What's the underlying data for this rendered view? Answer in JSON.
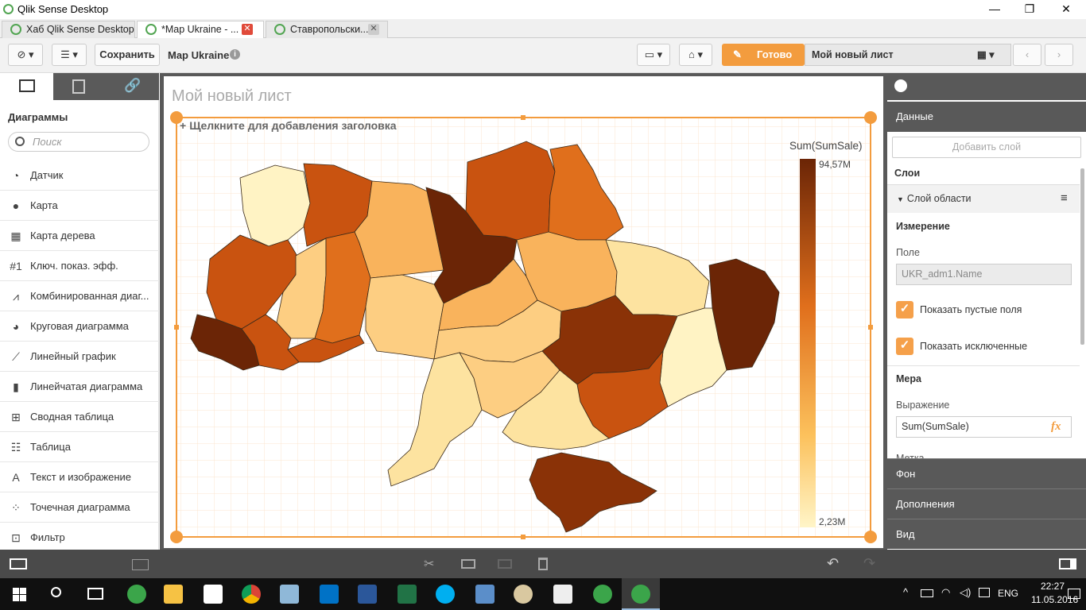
{
  "window": {
    "title": "Qlik Sense Desktop",
    "min": "—",
    "max": "❐",
    "close": "✕"
  },
  "tabs": [
    {
      "label": "Хаб Qlik Sense Desktop"
    },
    {
      "label": "*Map Ukraine - ..."
    },
    {
      "label": "Ставропольски..."
    }
  ],
  "toolbar": {
    "save_label": "Сохранить",
    "app_name": "Map Ukraine",
    "done_label": "Готово",
    "sheet_name": "Мой новый лист"
  },
  "left_panel": {
    "heading": "Диаграммы",
    "search_placeholder": "Поиск",
    "items": [
      {
        "label": "Датчик",
        "icon": "gauge-icon"
      },
      {
        "label": "Карта",
        "icon": "globe-icon"
      },
      {
        "label": "Карта дерева",
        "icon": "treemap-icon"
      },
      {
        "label": "Ключ. показ. эфф.",
        "icon": "kpi-icon"
      },
      {
        "label": "Комбинированная диаг...",
        "icon": "combo-chart-icon"
      },
      {
        "label": "Круговая диаграмма",
        "icon": "pie-chart-icon"
      },
      {
        "label": "Линейный график",
        "icon": "line-chart-icon"
      },
      {
        "label": "Линейчатая диаграмма",
        "icon": "bar-chart-icon"
      },
      {
        "label": "Сводная таблица",
        "icon": "pivot-table-icon"
      },
      {
        "label": "Таблица",
        "icon": "table-icon"
      },
      {
        "label": "Текст и изображение",
        "icon": "text-image-icon"
      },
      {
        "label": "Точечная диаграмма",
        "icon": "scatter-icon"
      },
      {
        "label": "Фильтр",
        "icon": "filter-icon"
      }
    ]
  },
  "sheet": {
    "title": "Мой новый лист",
    "chart_title_prompt": "Щелкните для добавления заголовка",
    "legend": {
      "title": "Sum(SumSale)",
      "max": "94,57M",
      "min": "2,23M"
    }
  },
  "right_panel": {
    "data_header": "Данные",
    "add_layer": "Добавить слой",
    "layers_label": "Слои",
    "layer_name": "Слой области",
    "dimension_heading": "Измерение",
    "field_label": "Поле",
    "field_value": "UKR_adm1.Name",
    "show_null": "Показать пустые поля",
    "show_excluded": "Показать исключенные",
    "measure_heading": "Мера",
    "expression_label": "Выражение",
    "expression_value": "Sum(SumSale)",
    "label_partial": "Метка",
    "sections": [
      "Фон",
      "Дополнения",
      "Вид"
    ]
  },
  "taskbar": {
    "lang": "ENG",
    "time": "22:27",
    "date": "11.05.2016"
  },
  "colors": {
    "accent": "#f39c3e",
    "map_low": "#fff3c4",
    "map_high": "#6b2506"
  }
}
